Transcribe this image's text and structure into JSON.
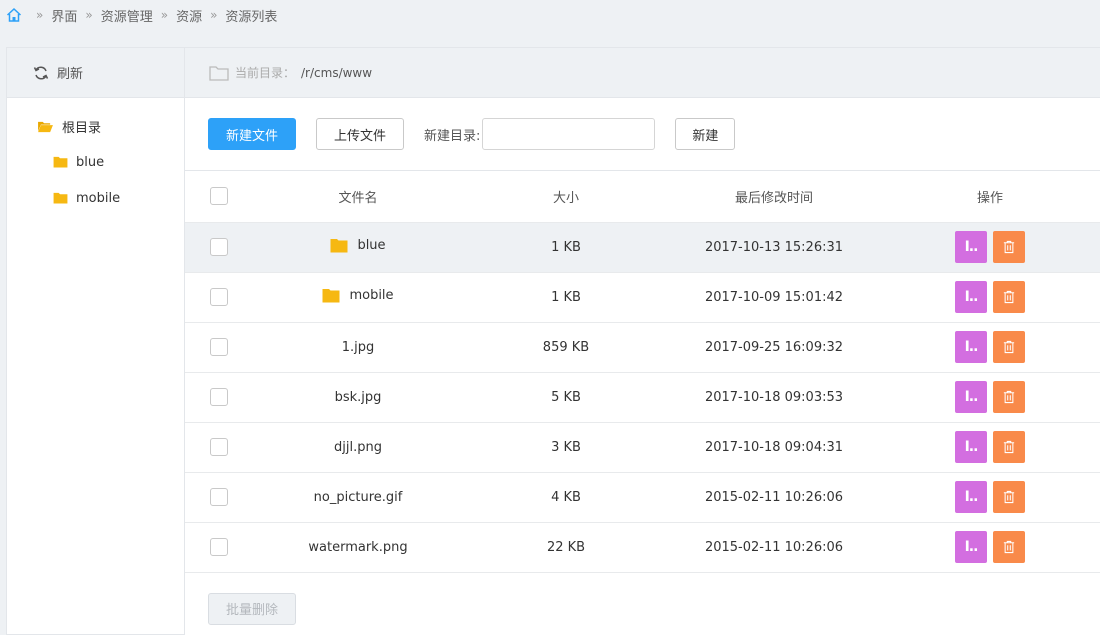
{
  "breadcrumb": {
    "items": [
      "界面",
      "资源管理",
      "资源",
      "资源列表"
    ]
  },
  "sidebar": {
    "refresh_label": "刷新",
    "root_label": "根目录",
    "children": [
      "blue",
      "mobile"
    ]
  },
  "dir": {
    "label": "当前目录：",
    "path": "/r/cms/www"
  },
  "toolbar": {
    "new_file": "新建文件",
    "upload_file": "上传文件",
    "new_dir_label": "新建目录:",
    "new_dir_value": "",
    "create": "新建"
  },
  "table": {
    "headers": [
      "文件名",
      "大小",
      "最后修改时间",
      "操作"
    ],
    "rows": [
      {
        "name": "blue",
        "folder": true,
        "size": "1 KB",
        "modified": "2017-10-13 15:26:31"
      },
      {
        "name": "mobile",
        "folder": true,
        "size": "1 KB",
        "modified": "2017-10-09 15:01:42"
      },
      {
        "name": "1.jpg",
        "folder": false,
        "size": "859 KB",
        "modified": "2017-09-25 16:09:32"
      },
      {
        "name": "bsk.jpg",
        "folder": false,
        "size": "5 KB",
        "modified": "2017-10-18 09:03:53"
      },
      {
        "name": "djjl.png",
        "folder": false,
        "size": "3 KB",
        "modified": "2017-10-18 09:04:31"
      },
      {
        "name": "no_picture.gif",
        "folder": false,
        "size": "4 KB",
        "modified": "2015-02-11 10:26:06"
      },
      {
        "name": "watermark.png",
        "folder": false,
        "size": "22 KB",
        "modified": "2015-02-11 10:26:06"
      }
    ],
    "rename_glyph": "I.."
  },
  "footer": {
    "batch_delete": "批量删除"
  },
  "colors": {
    "primary": "#2da1f8",
    "rename": "#d36ee0",
    "delete": "#f98a4a",
    "folder": "#f6b812"
  }
}
